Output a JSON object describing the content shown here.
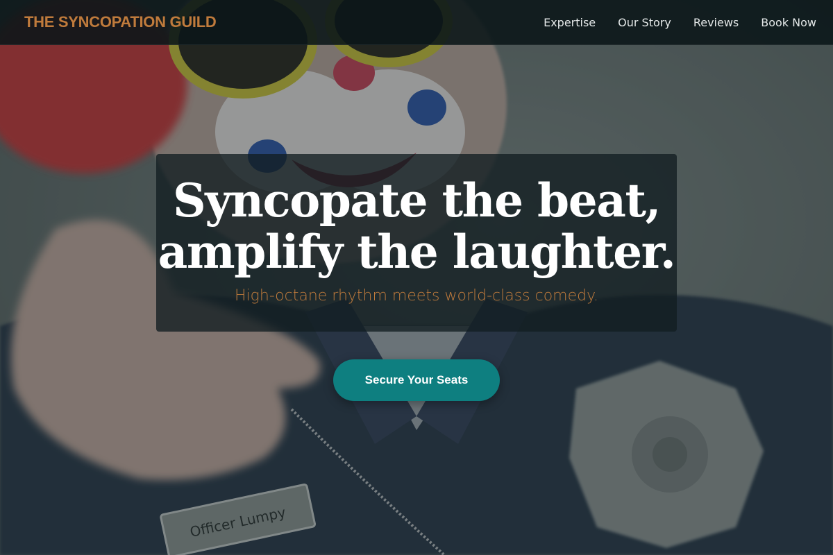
{
  "nav": {
    "brand": "THE SYNCOPATION GUILD",
    "links": [
      {
        "label": "Expertise"
      },
      {
        "label": "Our Story"
      },
      {
        "label": "Reviews"
      },
      {
        "label": "Book Now"
      }
    ]
  },
  "hero": {
    "headline_line1": "Syncopate the beat,",
    "headline_line2": "amplify the laughter.",
    "subheadline": "High-octane rhythm meets world-class comedy.",
    "cta_label": "Secure Your Seats",
    "photo_name_tag": "Officer Lumpy"
  },
  "colors": {
    "brand_accent": "#c07b3c",
    "cta_background": "#0e7f80",
    "nav_background": "#0a1618"
  }
}
